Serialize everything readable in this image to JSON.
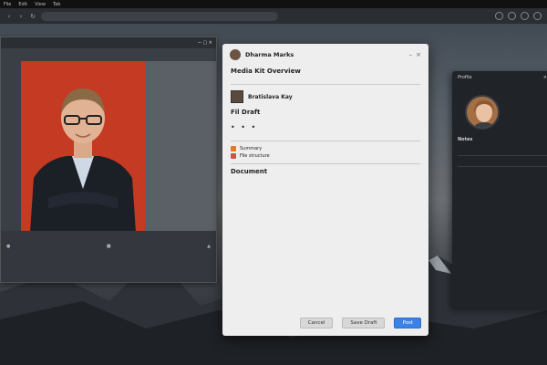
{
  "sysbar": {
    "items": [
      "File",
      "Edit",
      "View",
      "Tab"
    ]
  },
  "browser": {
    "url": ""
  },
  "video_window": {
    "title": "",
    "footer_left": "",
    "footer_right": ""
  },
  "dialog": {
    "author_name": "Dharma Marks",
    "author_sub": "",
    "section1_title": "Media Kit Overview",
    "section1_text": "",
    "post_author": "Bratislava Kay",
    "section2_title": "Fil Draft",
    "section2_text": "",
    "subsection_label": "",
    "bullets": [
      "Summary",
      "File structure"
    ],
    "section3_title": "Document",
    "section3_text": "",
    "cancel_label": "Cancel",
    "save_label": "Save Draft",
    "primary_label": "Post"
  },
  "rpanel": {
    "title": "Profile",
    "header": "",
    "name": "Notes",
    "items": [
      "",
      "",
      ""
    ],
    "section_label": "",
    "footer": ""
  }
}
